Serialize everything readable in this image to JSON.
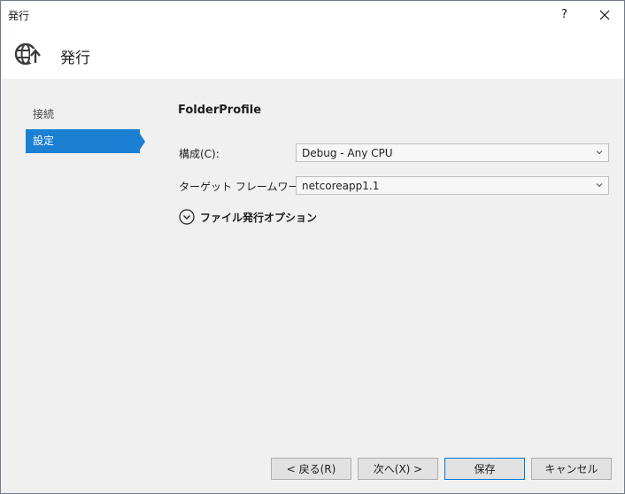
{
  "window": {
    "title": "発行",
    "help_glyph": "?",
    "close_glyph": "✕"
  },
  "header": {
    "title": "発行",
    "icon": "globe-publish-icon"
  },
  "nav": {
    "items": [
      {
        "label": "接続",
        "selected": false
      },
      {
        "label": "設定",
        "selected": true
      }
    ],
    "accent_color": "#1b7fd2"
  },
  "main": {
    "profile_name": "FolderProfile",
    "configuration": {
      "label": "構成(C):",
      "value": "Debug - Any CPU"
    },
    "target_framework": {
      "label": "ターゲット フレームワーク(F):",
      "value": "netcoreapp1.1"
    },
    "file_publish_options": {
      "label": "ファイル発行オプション",
      "expanded": false
    }
  },
  "buttons": {
    "back": "< 戻る(R)",
    "next": "次へ(X) >",
    "save": "保存",
    "cancel": "キャンセル"
  }
}
